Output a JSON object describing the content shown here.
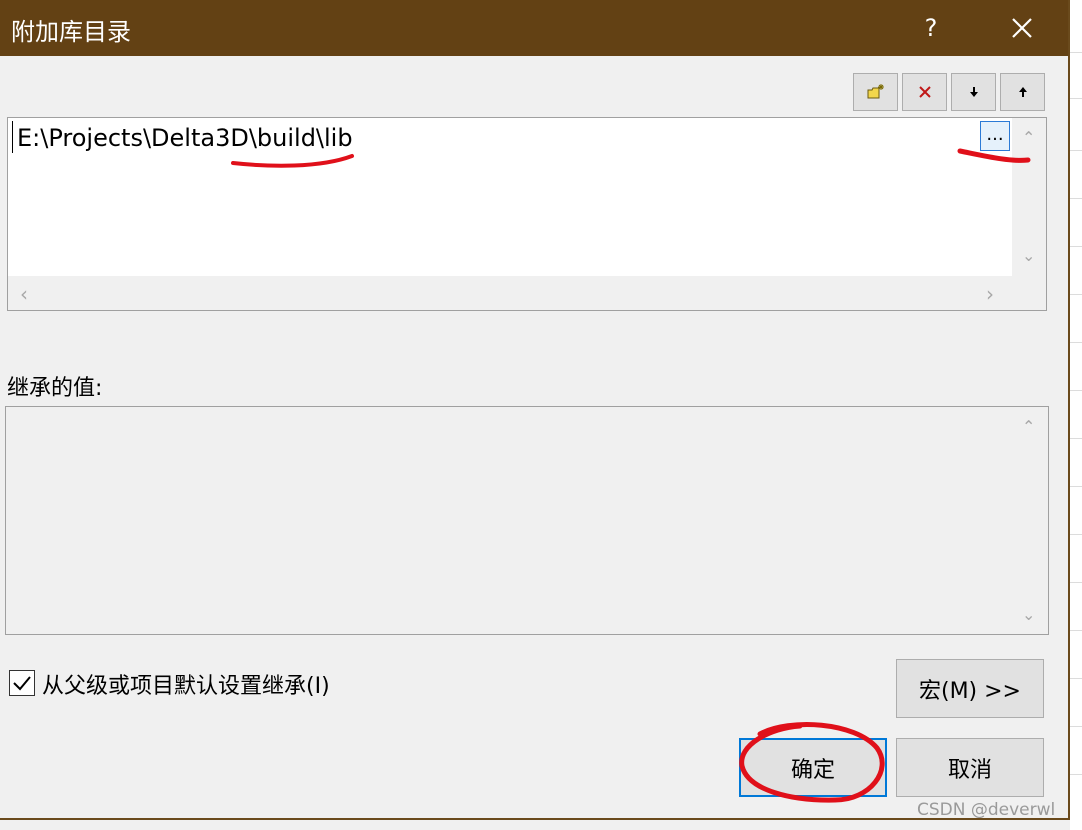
{
  "dialog": {
    "title": "附加库目录",
    "help_label": "?",
    "colors": {
      "titlebar": "#634114",
      "accent": "#0078d7",
      "annotation": "#e0101a"
    }
  },
  "toolbar": {
    "buttons": [
      {
        "name": "new-line-icon"
      },
      {
        "name": "delete-icon"
      },
      {
        "name": "move-down-icon"
      },
      {
        "name": "move-up-icon"
      }
    ]
  },
  "editor": {
    "lines": [
      "E:\\Projects\\Delta3D\\build\\lib"
    ],
    "browse_label": "..."
  },
  "inherited": {
    "label": "继承的值:",
    "values": []
  },
  "inherit_checkbox": {
    "label": "从父级或项目默认设置继承(I)",
    "checked": true
  },
  "buttons": {
    "macros": "宏(M) >>",
    "ok": "确定",
    "cancel": "取消"
  },
  "watermark": "CSDN @deverwl"
}
